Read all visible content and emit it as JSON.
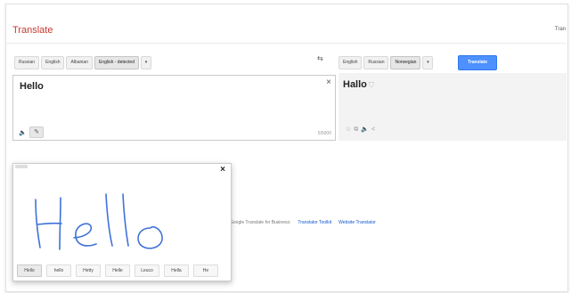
{
  "app": {
    "title": "Translate",
    "user": "Tran"
  },
  "source_langs": [
    {
      "label": "Russian",
      "selected": false
    },
    {
      "label": "English",
      "selected": false
    },
    {
      "label": "Albanian",
      "selected": false
    },
    {
      "label": "English - detected",
      "selected": true
    }
  ],
  "target_langs": [
    {
      "label": "English",
      "selected": false
    },
    {
      "label": "Russian",
      "selected": false
    },
    {
      "label": "Norwegian",
      "selected": true
    }
  ],
  "caret": "▾",
  "translate_button": "Translate",
  "source": {
    "text": "Hello",
    "counter": "5/5000"
  },
  "result": {
    "text": "Hallo"
  },
  "promo": {
    "text": "Google Translate for Business:",
    "link1": "Translator Toolkit",
    "link2": "Website Translator"
  },
  "handwriting": {
    "suggestions": [
      "Hello",
      "hello",
      "Hetty",
      "Helle",
      "Leuco",
      "Hella",
      "He"
    ]
  },
  "colors": {
    "accent": "#4d90fe",
    "brand_red": "#c6392f",
    "ink": "#3f71d9"
  }
}
